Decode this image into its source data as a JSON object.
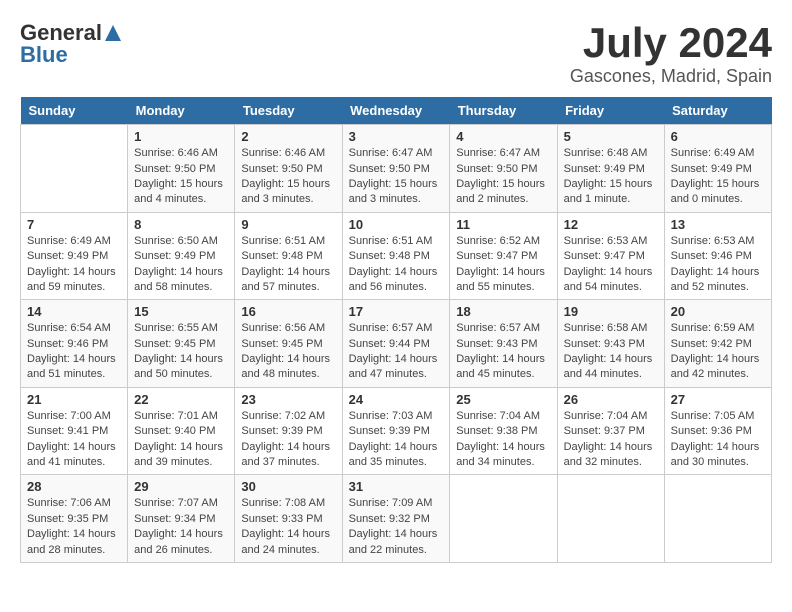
{
  "logo": {
    "general": "General",
    "blue": "Blue"
  },
  "title": "July 2024",
  "subtitle": "Gascones, Madrid, Spain",
  "days_header": [
    "Sunday",
    "Monday",
    "Tuesday",
    "Wednesday",
    "Thursday",
    "Friday",
    "Saturday"
  ],
  "weeks": [
    [
      {
        "day": "",
        "info": ""
      },
      {
        "day": "1",
        "info": "Sunrise: 6:46 AM\nSunset: 9:50 PM\nDaylight: 15 hours\nand 4 minutes."
      },
      {
        "day": "2",
        "info": "Sunrise: 6:46 AM\nSunset: 9:50 PM\nDaylight: 15 hours\nand 3 minutes."
      },
      {
        "day": "3",
        "info": "Sunrise: 6:47 AM\nSunset: 9:50 PM\nDaylight: 15 hours\nand 3 minutes."
      },
      {
        "day": "4",
        "info": "Sunrise: 6:47 AM\nSunset: 9:50 PM\nDaylight: 15 hours\nand 2 minutes."
      },
      {
        "day": "5",
        "info": "Sunrise: 6:48 AM\nSunset: 9:49 PM\nDaylight: 15 hours\nand 1 minute."
      },
      {
        "day": "6",
        "info": "Sunrise: 6:49 AM\nSunset: 9:49 PM\nDaylight: 15 hours\nand 0 minutes."
      }
    ],
    [
      {
        "day": "7",
        "info": "Sunrise: 6:49 AM\nSunset: 9:49 PM\nDaylight: 14 hours\nand 59 minutes."
      },
      {
        "day": "8",
        "info": "Sunrise: 6:50 AM\nSunset: 9:49 PM\nDaylight: 14 hours\nand 58 minutes."
      },
      {
        "day": "9",
        "info": "Sunrise: 6:51 AM\nSunset: 9:48 PM\nDaylight: 14 hours\nand 57 minutes."
      },
      {
        "day": "10",
        "info": "Sunrise: 6:51 AM\nSunset: 9:48 PM\nDaylight: 14 hours\nand 56 minutes."
      },
      {
        "day": "11",
        "info": "Sunrise: 6:52 AM\nSunset: 9:47 PM\nDaylight: 14 hours\nand 55 minutes."
      },
      {
        "day": "12",
        "info": "Sunrise: 6:53 AM\nSunset: 9:47 PM\nDaylight: 14 hours\nand 54 minutes."
      },
      {
        "day": "13",
        "info": "Sunrise: 6:53 AM\nSunset: 9:46 PM\nDaylight: 14 hours\nand 52 minutes."
      }
    ],
    [
      {
        "day": "14",
        "info": "Sunrise: 6:54 AM\nSunset: 9:46 PM\nDaylight: 14 hours\nand 51 minutes."
      },
      {
        "day": "15",
        "info": "Sunrise: 6:55 AM\nSunset: 9:45 PM\nDaylight: 14 hours\nand 50 minutes."
      },
      {
        "day": "16",
        "info": "Sunrise: 6:56 AM\nSunset: 9:45 PM\nDaylight: 14 hours\nand 48 minutes."
      },
      {
        "day": "17",
        "info": "Sunrise: 6:57 AM\nSunset: 9:44 PM\nDaylight: 14 hours\nand 47 minutes."
      },
      {
        "day": "18",
        "info": "Sunrise: 6:57 AM\nSunset: 9:43 PM\nDaylight: 14 hours\nand 45 minutes."
      },
      {
        "day": "19",
        "info": "Sunrise: 6:58 AM\nSunset: 9:43 PM\nDaylight: 14 hours\nand 44 minutes."
      },
      {
        "day": "20",
        "info": "Sunrise: 6:59 AM\nSunset: 9:42 PM\nDaylight: 14 hours\nand 42 minutes."
      }
    ],
    [
      {
        "day": "21",
        "info": "Sunrise: 7:00 AM\nSunset: 9:41 PM\nDaylight: 14 hours\nand 41 minutes."
      },
      {
        "day": "22",
        "info": "Sunrise: 7:01 AM\nSunset: 9:40 PM\nDaylight: 14 hours\nand 39 minutes."
      },
      {
        "day": "23",
        "info": "Sunrise: 7:02 AM\nSunset: 9:39 PM\nDaylight: 14 hours\nand 37 minutes."
      },
      {
        "day": "24",
        "info": "Sunrise: 7:03 AM\nSunset: 9:39 PM\nDaylight: 14 hours\nand 35 minutes."
      },
      {
        "day": "25",
        "info": "Sunrise: 7:04 AM\nSunset: 9:38 PM\nDaylight: 14 hours\nand 34 minutes."
      },
      {
        "day": "26",
        "info": "Sunrise: 7:04 AM\nSunset: 9:37 PM\nDaylight: 14 hours\nand 32 minutes."
      },
      {
        "day": "27",
        "info": "Sunrise: 7:05 AM\nSunset: 9:36 PM\nDaylight: 14 hours\nand 30 minutes."
      }
    ],
    [
      {
        "day": "28",
        "info": "Sunrise: 7:06 AM\nSunset: 9:35 PM\nDaylight: 14 hours\nand 28 minutes."
      },
      {
        "day": "29",
        "info": "Sunrise: 7:07 AM\nSunset: 9:34 PM\nDaylight: 14 hours\nand 26 minutes."
      },
      {
        "day": "30",
        "info": "Sunrise: 7:08 AM\nSunset: 9:33 PM\nDaylight: 14 hours\nand 24 minutes."
      },
      {
        "day": "31",
        "info": "Sunrise: 7:09 AM\nSunset: 9:32 PM\nDaylight: 14 hours\nand 22 minutes."
      },
      {
        "day": "",
        "info": ""
      },
      {
        "day": "",
        "info": ""
      },
      {
        "day": "",
        "info": ""
      }
    ]
  ]
}
